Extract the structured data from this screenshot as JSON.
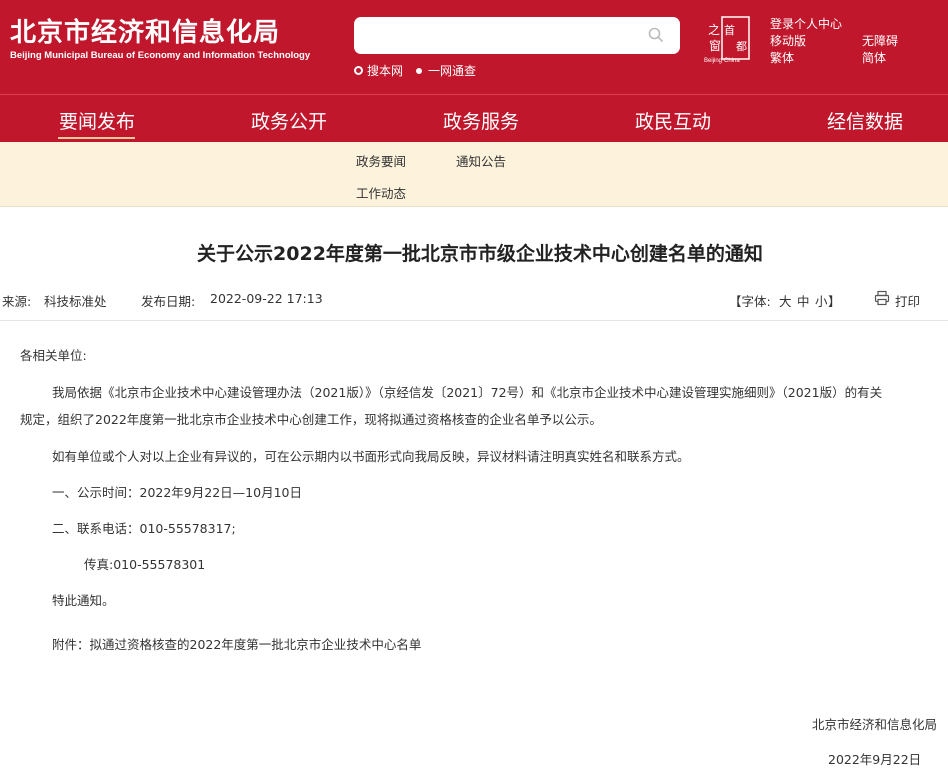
{
  "header": {
    "logo_cn": "北京市经济和信息化局",
    "logo_en": "Beijing Municipal Bureau of Economy and Information Technology",
    "search": {
      "placeholder": "",
      "scope_site": "搜本网",
      "scope_all": "一网通查"
    },
    "seal_chars": [
      "之",
      "首",
      "都",
      "窗"
    ],
    "seal_en": "Beijing·China",
    "links": {
      "login": "登录个人中心",
      "mobile": "移动版",
      "accessible": "无障碍",
      "traditional": "繁体",
      "simplified": "简体"
    }
  },
  "nav": {
    "items": [
      "要闻发布",
      "政务公开",
      "政务服务",
      "政民互动",
      "经信数据"
    ],
    "active": "要闻发布",
    "sub_items": [
      "政务要闻",
      "通知公告",
      "工作动态"
    ]
  },
  "article": {
    "title": "关于公示2022年度第一批北京市市级企业技术中心创建名单的通知",
    "source_label": "来源:",
    "source": "科技标准处",
    "date_label": "发布日期:",
    "date": "2022-09-22 17:13",
    "font_label_open": "【字体:",
    "font_large": "大",
    "font_medium": "中",
    "font_small": "小",
    "font_label_close": "】",
    "print": "打印",
    "greeting": "各相关单位:",
    "p1_line1": "我局依据《北京市企业技术中心建设管理办法（2021版）》（京经信发〔2021〕72号）和《北京市企业技术中心建设管理实施细则》（2021版）的有关",
    "p1_line2": "规定，组织了2022年度第一批北京市企业技术中心创建工作，现将拟通过资格核查的企业名单予以公示。",
    "p2": "如有单位或个人对以上企业有异议的，可在公示期内以书面形式向我局反映，异议材料请注明真实姓名和联系方式。",
    "p3": "一、公示时间：2022年9月22日—10月10日",
    "p4": "二、联系电话：010-55578317;",
    "p5": "传真:010-55578301",
    "p6": "特此通知。",
    "attachment": "附件：拟通过资格核查的2022年度第一批北京市企业技术中心名单",
    "signature": "北京市经济和信息化局",
    "sign_date": "2022年9月22日"
  },
  "colors": {
    "brand_red": "#c0172c",
    "subnav_bg": "#fdf3dc",
    "nav_underline": "#f0c99a"
  }
}
